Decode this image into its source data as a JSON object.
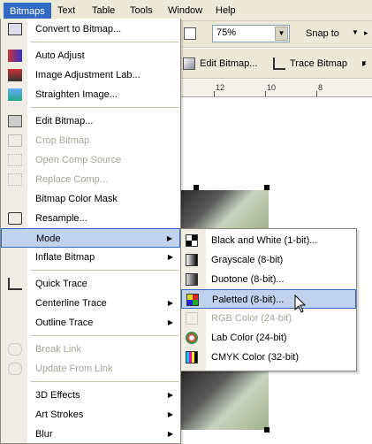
{
  "menubar": {
    "items": [
      "Bitmaps",
      "Text",
      "Table",
      "Tools",
      "Window",
      "Help"
    ],
    "access_keys": [
      "B",
      "x",
      "T",
      "o",
      "W",
      "H"
    ]
  },
  "toolbar": {
    "zoom_value": "75%",
    "snap_label": "Snap to",
    "edit_bitmap_label": "Edit Bitmap...",
    "trace_bitmap_label": "Trace Bitmap"
  },
  "ruler": {
    "ticks": [
      "12",
      "10",
      "8"
    ]
  },
  "bitmaps_menu": {
    "items": [
      {
        "label": "Convert to Bitmap...",
        "icon": "convert-bitmap-icon",
        "enabled": true
      },
      {
        "label": "Auto Adjust",
        "icon": "auto-adjust-icon",
        "enabled": true
      },
      {
        "label": "Image Adjustment Lab...",
        "icon": "image-adjustment-lab-icon",
        "enabled": true
      },
      {
        "label": "Straighten Image...",
        "icon": "straighten-image-icon",
        "enabled": true
      },
      {
        "label": "Edit Bitmap...",
        "icon": "edit-bitmap-icon",
        "enabled": true
      },
      {
        "label": "Crop Bitmap",
        "icon": "crop-bitmap-icon",
        "enabled": false
      },
      {
        "label": "Open Comp Source",
        "icon": "open-comp-source-icon",
        "enabled": false
      },
      {
        "label": "Replace Comp...",
        "icon": "replace-comp-icon",
        "enabled": false
      },
      {
        "label": "Bitmap Color Mask",
        "icon": "",
        "enabled": true
      },
      {
        "label": "Resample...",
        "icon": "resample-icon",
        "enabled": true
      },
      {
        "label": "Mode",
        "icon": "",
        "enabled": true,
        "submenu": true
      },
      {
        "label": "Inflate Bitmap",
        "icon": "",
        "enabled": true,
        "submenu": true
      },
      {
        "label": "Quick Trace",
        "icon": "quick-trace-icon",
        "enabled": true
      },
      {
        "label": "Centerline Trace",
        "icon": "",
        "enabled": true,
        "submenu": true
      },
      {
        "label": "Outline Trace",
        "icon": "",
        "enabled": true,
        "submenu": true
      },
      {
        "label": "Break Link",
        "icon": "break-link-icon",
        "enabled": false
      },
      {
        "label": "Update From Link",
        "icon": "update-from-link-icon",
        "enabled": false
      },
      {
        "label": "3D Effects",
        "icon": "",
        "enabled": true,
        "submenu": true
      },
      {
        "label": "Art Strokes",
        "icon": "",
        "enabled": true,
        "submenu": true
      },
      {
        "label": "Blur",
        "icon": "",
        "enabled": true,
        "submenu": true
      }
    ]
  },
  "mode_submenu": {
    "items": [
      {
        "label": "Black and White (1-bit)...",
        "icon": "black-and-white-icon",
        "enabled": true
      },
      {
        "label": "Grayscale (8-bit)",
        "icon": "grayscale-icon",
        "enabled": true
      },
      {
        "label": "Duotone (8-bit)...",
        "icon": "duotone-icon",
        "enabled": true
      },
      {
        "label": "Paletted (8-bit)...",
        "icon": "paletted-icon",
        "enabled": true
      },
      {
        "label": "RGB Color (24-bit)",
        "icon": "rgb-color-icon",
        "enabled": false
      },
      {
        "label": "Lab Color (24-bit)",
        "icon": "lab-color-icon",
        "enabled": true
      },
      {
        "label": "CMYK Color (32-bit)",
        "icon": "cmyk-color-icon",
        "enabled": true
      }
    ]
  },
  "colors": {
    "highlight": "#c1d2ee",
    "highlight_border": "#316ac5",
    "menubar_active": "#316ac5"
  }
}
